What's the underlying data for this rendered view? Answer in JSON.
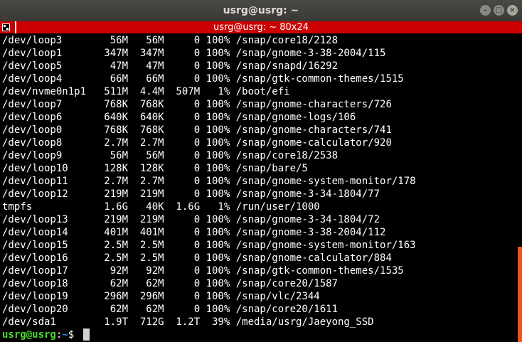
{
  "window": {
    "title": "usrg@usrg: ~",
    "buttons": {
      "minimize": "–",
      "maximize": "□",
      "close": "×"
    }
  },
  "tab": {
    "title": "usrg@usrg: ~ 80x24"
  },
  "terminal": {
    "lines": [
      "/dev/loop3        56M   56M     0 100% /snap/core18/2128",
      "/dev/loop1       347M  347M     0 100% /snap/gnome-3-38-2004/115",
      "/dev/loop5        47M   47M     0 100% /snap/snapd/16292",
      "/dev/loop4        66M   66M     0 100% /snap/gtk-common-themes/1515",
      "/dev/nvme0n1p1   511M  4.4M  507M   1% /boot/efi",
      "/dev/loop7       768K  768K     0 100% /snap/gnome-characters/726",
      "/dev/loop6       640K  640K     0 100% /snap/gnome-logs/106",
      "/dev/loop0       768K  768K     0 100% /snap/gnome-characters/741",
      "/dev/loop8       2.7M  2.7M     0 100% /snap/gnome-calculator/920",
      "/dev/loop9        56M   56M     0 100% /snap/core18/2538",
      "/dev/loop10      128K  128K     0 100% /snap/bare/5",
      "/dev/loop11      2.7M  2.7M     0 100% /snap/gnome-system-monitor/178",
      "/dev/loop12      219M  219M     0 100% /snap/gnome-3-34-1804/77",
      "tmpfs            1.6G   40K  1.6G   1% /run/user/1000",
      "/dev/loop13      219M  219M     0 100% /snap/gnome-3-34-1804/72",
      "/dev/loop14      401M  401M     0 100% /snap/gnome-3-38-2004/112",
      "/dev/loop15      2.5M  2.5M     0 100% /snap/gnome-system-monitor/163",
      "/dev/loop16      2.5M  2.5M     0 100% /snap/gnome-calculator/884",
      "/dev/loop17       92M   92M     0 100% /snap/gtk-common-themes/1535",
      "/dev/loop18       62M   62M     0 100% /snap/core20/1587",
      "/dev/loop19      296M  296M     0 100% /snap/vlc/2344",
      "/dev/loop20       62M   62M     0 100% /snap/core20/1611",
      "/dev/sda1        1.9T  712G  1.2T  39% /media/usrg/Jaeyong_SSD"
    ],
    "prompt": {
      "user_host": "usrg@usrg",
      "colon": ":",
      "path": "~",
      "symbol": "$"
    }
  },
  "colors": {
    "tab_bar": "#cc0000",
    "prompt_user": "#4ad92a",
    "prompt_path": "#3f8cf0",
    "scrollbar": "#e95420"
  }
}
